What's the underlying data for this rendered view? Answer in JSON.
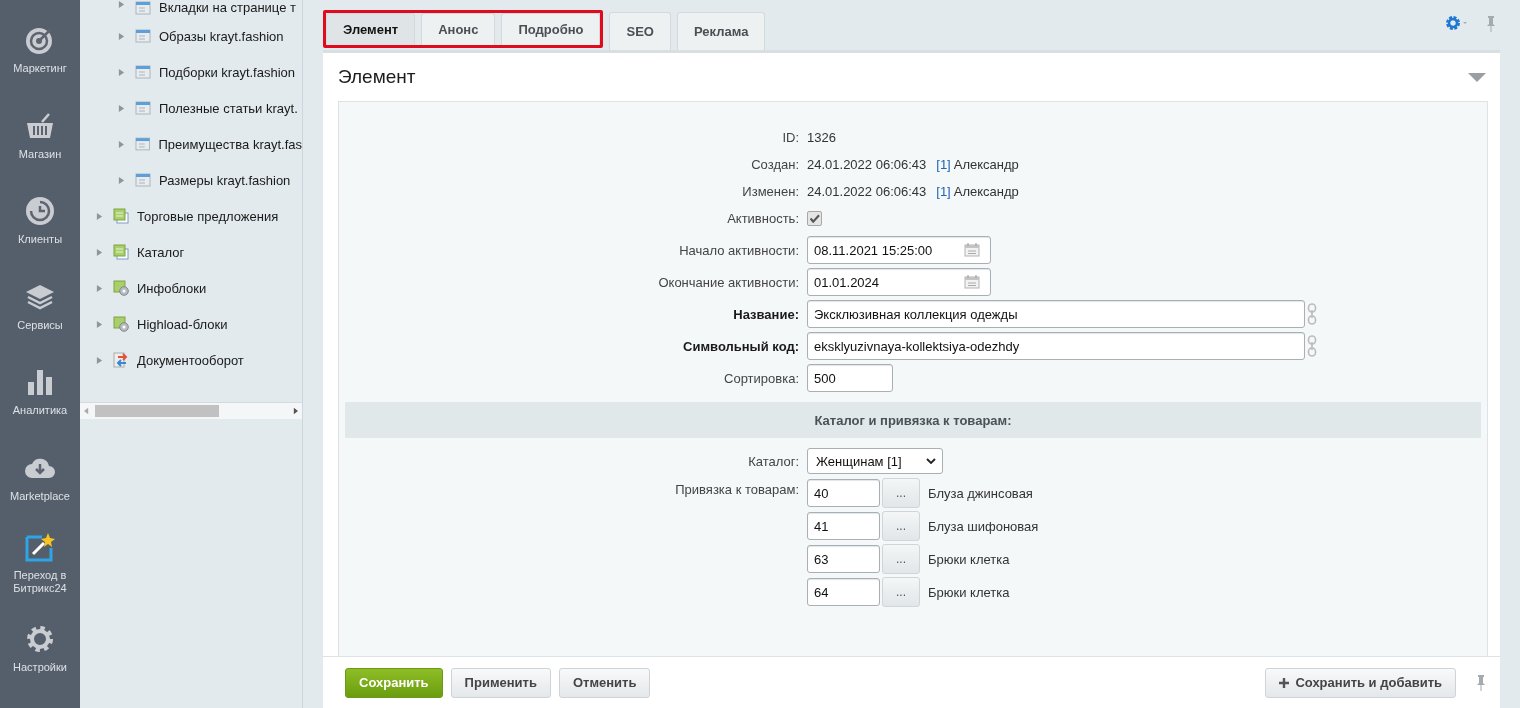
{
  "rail": [
    {
      "label": "Маркетинг"
    },
    {
      "label": "Магазин"
    },
    {
      "label": "Клиенты"
    },
    {
      "label": "Сервисы"
    },
    {
      "label": "Аналитика"
    },
    {
      "label": "Marketplace"
    },
    {
      "label": "Переход в Битрикс24"
    },
    {
      "label": "Настройки"
    }
  ],
  "tree": [
    {
      "children": [
        {
          "label": "Вкладки на странице т",
          "kind": "list"
        },
        {
          "label": "Образы krayt.fashion",
          "kind": "list"
        },
        {
          "label": "Подборки krayt.fashion",
          "kind": "list"
        },
        {
          "label": "Полезные статьи krayt.",
          "kind": "list"
        },
        {
          "label": "Преимущества krayt.fas",
          "kind": "list"
        },
        {
          "label": "Размеры krayt.fashion",
          "kind": "list"
        }
      ]
    },
    {
      "label": "Торговые предложения",
      "kind": "catalog"
    },
    {
      "label": "Каталог",
      "kind": "catalog"
    },
    {
      "label": "Инфоблоки",
      "kind": "module"
    },
    {
      "label": "Highload-блоки",
      "kind": "module"
    },
    {
      "label": "Документооборот",
      "kind": "workflow"
    }
  ],
  "tabs": [
    {
      "label": "Элемент",
      "selected": true,
      "highlighted": true
    },
    {
      "label": "Анонс",
      "selected": false,
      "highlighted": true
    },
    {
      "label": "Подробно",
      "selected": false,
      "highlighted": true
    },
    {
      "label": "SEO",
      "selected": false,
      "highlighted": false
    },
    {
      "label": "Реклама",
      "selected": false,
      "highlighted": false
    }
  ],
  "section_title": "Элемент",
  "fields": [
    {
      "kind": "info",
      "label": "ID:",
      "value": "1326"
    },
    {
      "kind": "meta",
      "label": "Создан:",
      "value": "24.01.2022 06:06:43",
      "user_id": "[1]",
      "user": "Александр"
    },
    {
      "kind": "meta",
      "label": "Изменен:",
      "value": "24.01.2022 06:06:43",
      "user_id": "[1]",
      "user": "Александр"
    },
    {
      "kind": "checkbox",
      "label": "Активность:",
      "checked": true
    },
    {
      "kind": "date",
      "label": "Начало активности:",
      "value": "08.11.2021 15:25:00"
    },
    {
      "kind": "date",
      "label": "Окончание активности:",
      "value": "01.01.2024"
    },
    {
      "kind": "translit",
      "label": "Название:",
      "required": true,
      "value": "Эксклюзивная коллекция одежды"
    },
    {
      "kind": "translit",
      "label": "Символьный код:",
      "required": true,
      "value": "eksklyuzivnaya-kollektsiya-odezhdy"
    },
    {
      "kind": "short",
      "label": "Сортировка:",
      "required": false,
      "value": "500"
    },
    {
      "kind": "heading",
      "label": "Каталог и привязка к товарам:"
    },
    {
      "kind": "select",
      "label": "Каталог:",
      "value": "Женщинам [1]"
    },
    {
      "kind": "bindings",
      "label": "Привязка к товарам:",
      "items": [
        {
          "id": "40",
          "button": "...",
          "name": "Блуза джинсовая"
        },
        {
          "id": "41",
          "button": "...",
          "name": "Блуза шифоновая"
        },
        {
          "id": "63",
          "button": "...",
          "name": "Брюки клетка"
        },
        {
          "id": "64",
          "button": "...",
          "name": "Брюки клетка"
        }
      ]
    }
  ],
  "footer": [
    {
      "label": "Сохранить",
      "kind": "primary"
    },
    {
      "label": "Применить",
      "kind": "default"
    },
    {
      "label": "Отменить",
      "kind": "default"
    },
    {
      "label": "Сохранить и добавить",
      "kind": "add"
    }
  ]
}
